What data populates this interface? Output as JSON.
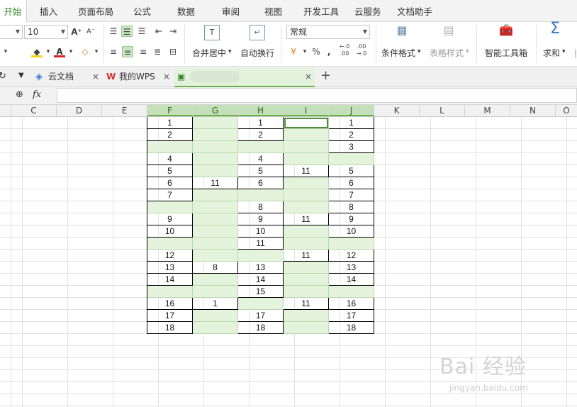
{
  "menu": {
    "items": [
      "开始",
      "插入",
      "页面布局",
      "公式",
      "数据",
      "审阅",
      "视图",
      "开发工具",
      "云服务",
      "文档助手"
    ],
    "active_index": 0
  },
  "ribbon": {
    "font_size": "10",
    "number_format": "常规",
    "merge_center": "合并居中",
    "wrap_text": "自动换行",
    "conditional_format": "条件格式",
    "table_style": "表格样式",
    "smart_toolbox": "智能工具箱",
    "sum": "求和",
    "percent": "%",
    "thousands": "ﾞ",
    "dec_inc": ".0\n.00",
    "dec_dec": ".00\n.0"
  },
  "tabs": [
    {
      "label": "云文档"
    },
    {
      "label": "我的WPS"
    },
    {
      "label": ""
    }
  ],
  "formula_bar": {
    "fx": "fx"
  },
  "columns": [
    "C",
    "D",
    "E",
    "F",
    "G",
    "H",
    "I",
    "J",
    "K",
    "L",
    "M",
    "N",
    "O"
  ],
  "selected_columns": [
    "F",
    "G",
    "H",
    "I",
    "J"
  ],
  "table": {
    "rows": [
      [
        "1",
        "",
        "1",
        "",
        "1"
      ],
      [
        "2",
        "",
        "2",
        "",
        "2"
      ],
      [
        "",
        "",
        "",
        "",
        "3"
      ],
      [
        "4",
        "",
        "4",
        "",
        ""
      ],
      [
        "5",
        "",
        "5",
        "11",
        "5"
      ],
      [
        "6",
        "11",
        "6",
        "",
        "6"
      ],
      [
        "7",
        "",
        "",
        "",
        "7"
      ],
      [
        "",
        "",
        "8",
        "",
        "8"
      ],
      [
        "9",
        "",
        "9",
        "11",
        "9"
      ],
      [
        "10",
        "",
        "10",
        "",
        "10"
      ],
      [
        "",
        "",
        "11",
        "",
        ""
      ],
      [
        "12",
        "",
        "",
        "11",
        "12"
      ],
      [
        "13",
        "8",
        "13",
        "",
        "13"
      ],
      [
        "14",
        "",
        "14",
        "",
        "14"
      ],
      [
        "",
        "",
        "15",
        "",
        ""
      ],
      [
        "16",
        "1",
        "",
        "11",
        "16"
      ],
      [
        "17",
        "",
        "17",
        "",
        "17"
      ],
      [
        "18",
        "",
        "18",
        "",
        "18"
      ]
    ]
  },
  "watermark": {
    "main": "Bai 经验",
    "sub": "jingyan.baidu.com"
  },
  "colors": {
    "accent": "#6ab04c",
    "empty_cell": "#e4f3dc"
  }
}
